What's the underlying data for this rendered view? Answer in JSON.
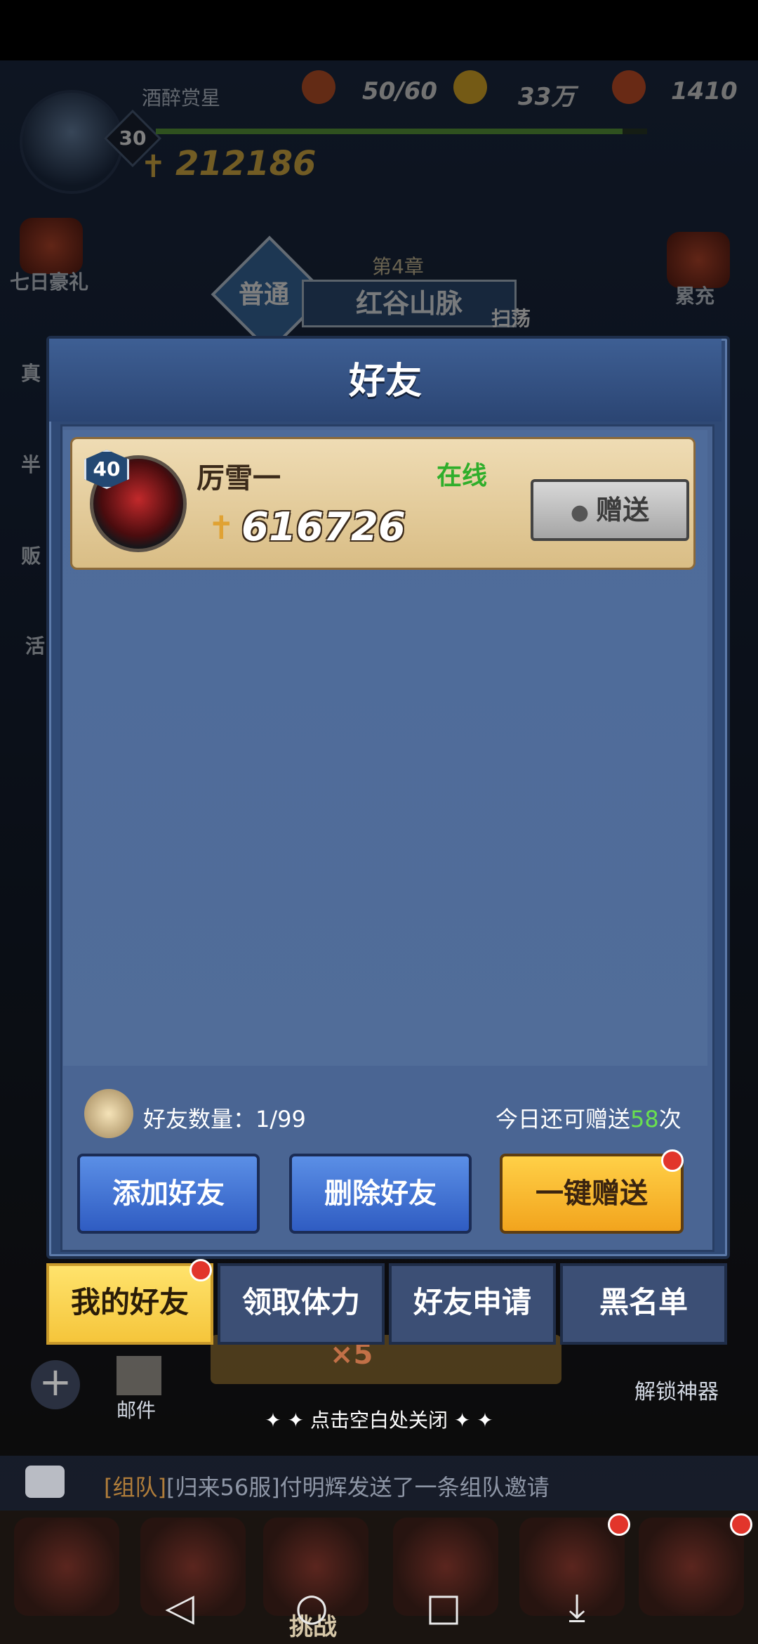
{
  "hud": {
    "player_name": "酒醉赏星",
    "level": "30",
    "power": "212186",
    "stamina": "50/60",
    "gold": "33万",
    "gems": "1410"
  },
  "side_menu": {
    "seven_day": "七日豪礼",
    "cumulative": "累充",
    "left_1": "真",
    "left_2": "半",
    "left_3": "贩",
    "left_4": "活"
  },
  "chapter": {
    "tag": "普通",
    "number": "第4章",
    "name": "红谷山脉",
    "sweep": "扫荡"
  },
  "dialog": {
    "title": "好友",
    "friend": {
      "level": "40",
      "name": "厉雪一",
      "status": "在线",
      "power": "616726",
      "gift_label": "赠送"
    },
    "count_label": "好友数量：1/99",
    "remain_prefix": "今日还可赠送",
    "remain_count": "58",
    "remain_suffix": "次",
    "buttons": {
      "add": "添加好友",
      "delete": "删除好友",
      "gift_all": "一键赠送"
    },
    "tabs": [
      "我的好友",
      "领取体力",
      "好友申请",
      "黑名单"
    ]
  },
  "background_bits": {
    "mail": "邮件",
    "unlock": "解锁神器",
    "x5": "×5"
  },
  "close_hint": "点击空白处关闭",
  "chat": {
    "tag": "[组队]",
    "message": "[归来56服]付明辉发送了一条组队邀请"
  },
  "bottom_nav": {
    "challenge": "挑战"
  },
  "colors": {
    "dialog_bg": "#2f4975",
    "gold_button": "#f5b52a",
    "online_green": "#2fae2b",
    "remain_green": "#69e04e"
  }
}
